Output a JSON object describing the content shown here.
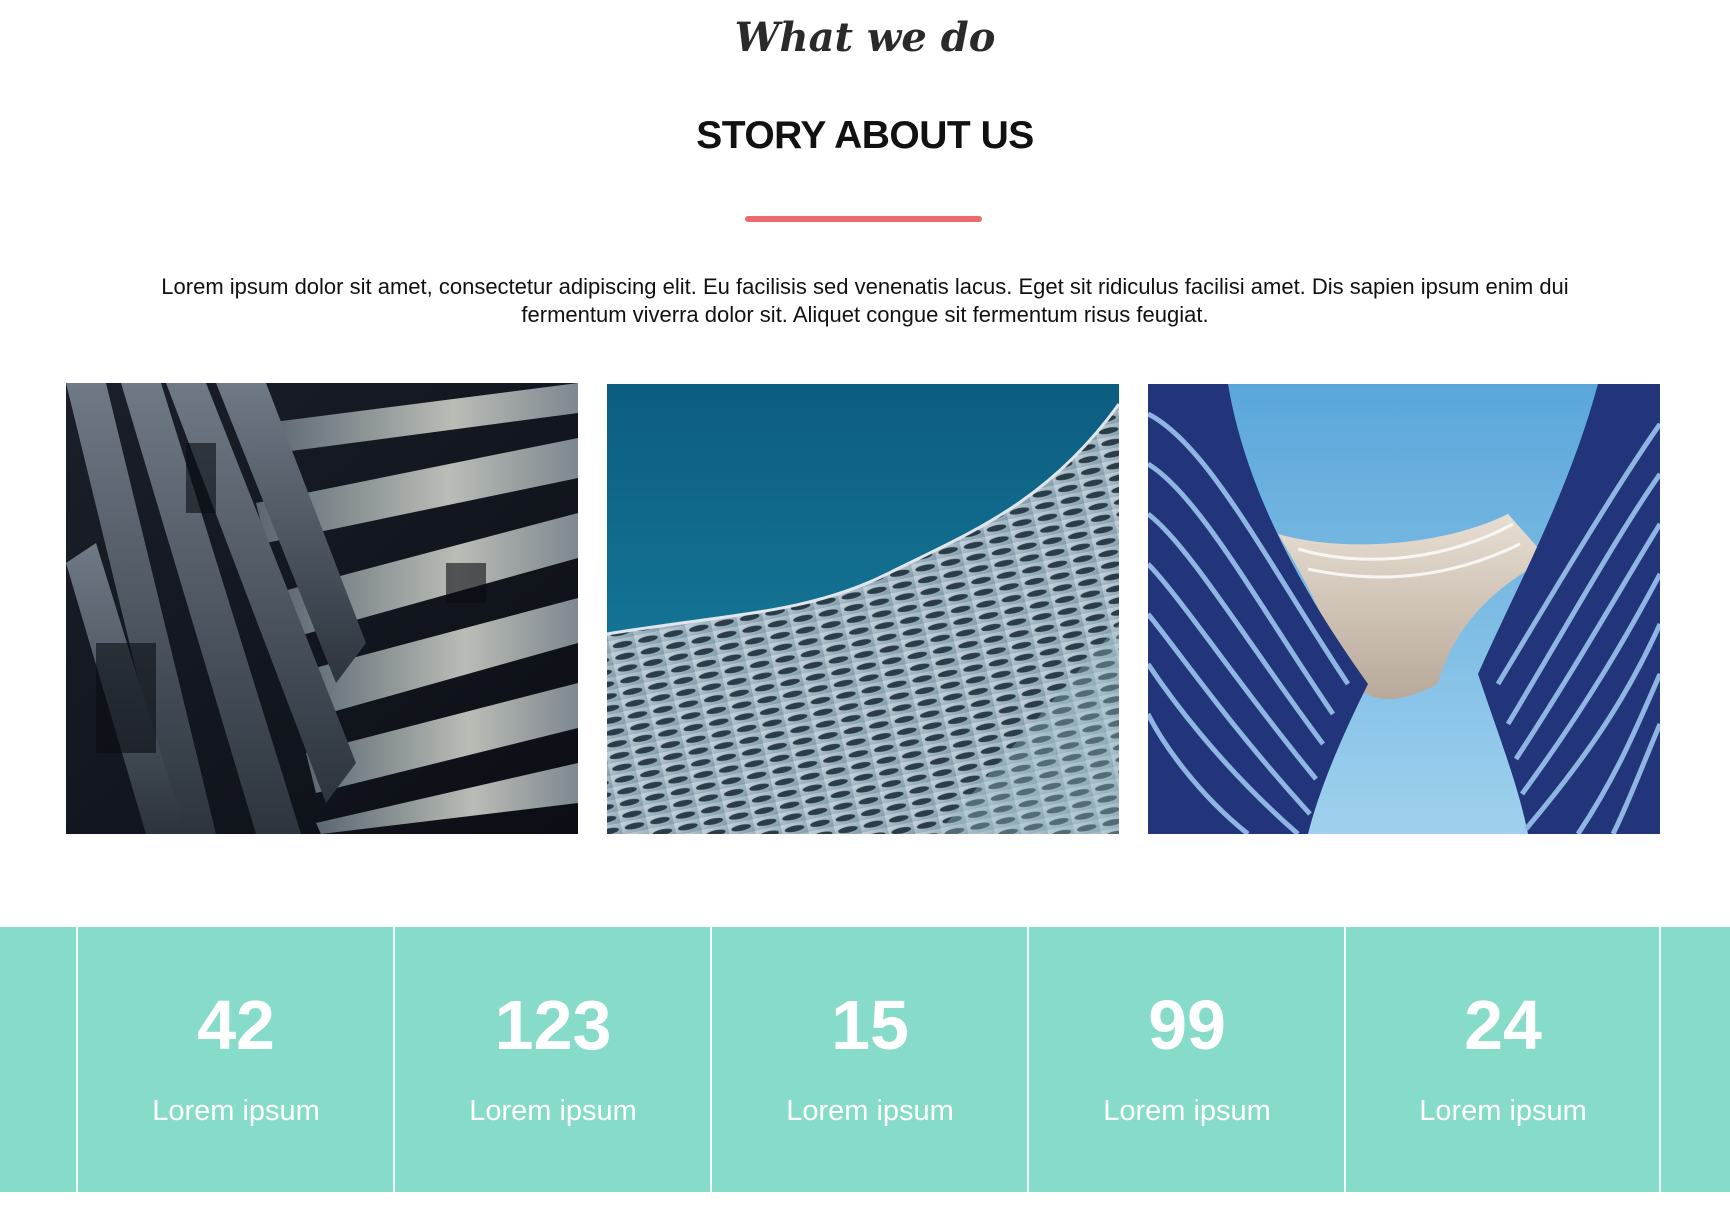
{
  "section": {
    "eyebrow": "What we do",
    "title": "STORY ABOUT US",
    "intro": "Lorem ipsum dolor sit amet, consectetur adipiscing elit. Eu facilisis sed venenatis lacus. Eget sit ridiculus facilisi amet. Dis sapien ipsum enim dui fermentum viverra dolor sit. Aliquet congue sit fermentum risus feugiat."
  },
  "colors": {
    "accent": "#ec6b6b",
    "stats_bg": "#86dcc9",
    "text": "#111111"
  },
  "gallery": {
    "images": [
      {
        "name": "dark-angular-building-photo"
      },
      {
        "name": "mesh-facade-blue-sky-photo"
      },
      {
        "name": "curved-blue-towers-photo"
      }
    ]
  },
  "stats": {
    "items": [
      {
        "number": "42",
        "label": "Lorem ipsum"
      },
      {
        "number": "123",
        "label": "Lorem ipsum"
      },
      {
        "number": "15",
        "label": "Lorem ipsum"
      },
      {
        "number": "99",
        "label": "Lorem ipsum"
      },
      {
        "number": "24",
        "label": "Lorem ipsum"
      }
    ]
  }
}
